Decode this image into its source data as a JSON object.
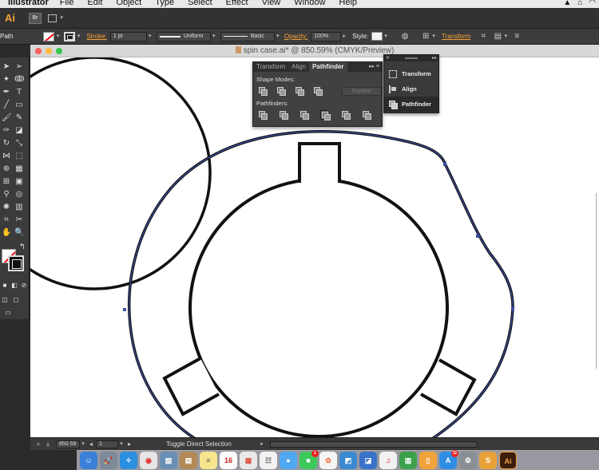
{
  "menubar": {
    "app_name": "Illustrator",
    "items": [
      "File",
      "Edit",
      "Object",
      "Type",
      "Select",
      "Effect",
      "View",
      "Window",
      "Help"
    ]
  },
  "appbar": {
    "logo": "Ai",
    "bridge": "Br"
  },
  "controlbar": {
    "selection_type": "Path",
    "stroke_label": "Stroke:",
    "stroke_weight": "1 pt",
    "variable_width": "Uniform",
    "brush": "Basic",
    "opacity_label": "Opacity:",
    "opacity_value": "100%",
    "style_label": "Style:",
    "transform_label": "Transform"
  },
  "document": {
    "title": "spin case.ai* @ 850.59% (CMYK/Preview)",
    "zoom": "850.59",
    "artboard": "1",
    "status_text": "Toggle Direct Selection"
  },
  "pathfinder_panel": {
    "tabs": [
      "Transform",
      "Align",
      "Pathfinder"
    ],
    "active_tab": "Pathfinder",
    "shape_modes_label": "Shape Modes:",
    "expand_label": "Expand",
    "pathfinders_label": "Pathfinders:"
  },
  "dock_panel": {
    "items": [
      "Transform",
      "Align",
      "Pathfinder"
    ]
  },
  "dock": {
    "calendar_day": "16",
    "badge_messages": "1",
    "badge_appstore": "11",
    "ai_label": "Ai"
  },
  "colors": {
    "accent": "#f7a33a",
    "selection": "#3d4fa3",
    "canvas": "#ffffff",
    "stroke": "#111111"
  }
}
